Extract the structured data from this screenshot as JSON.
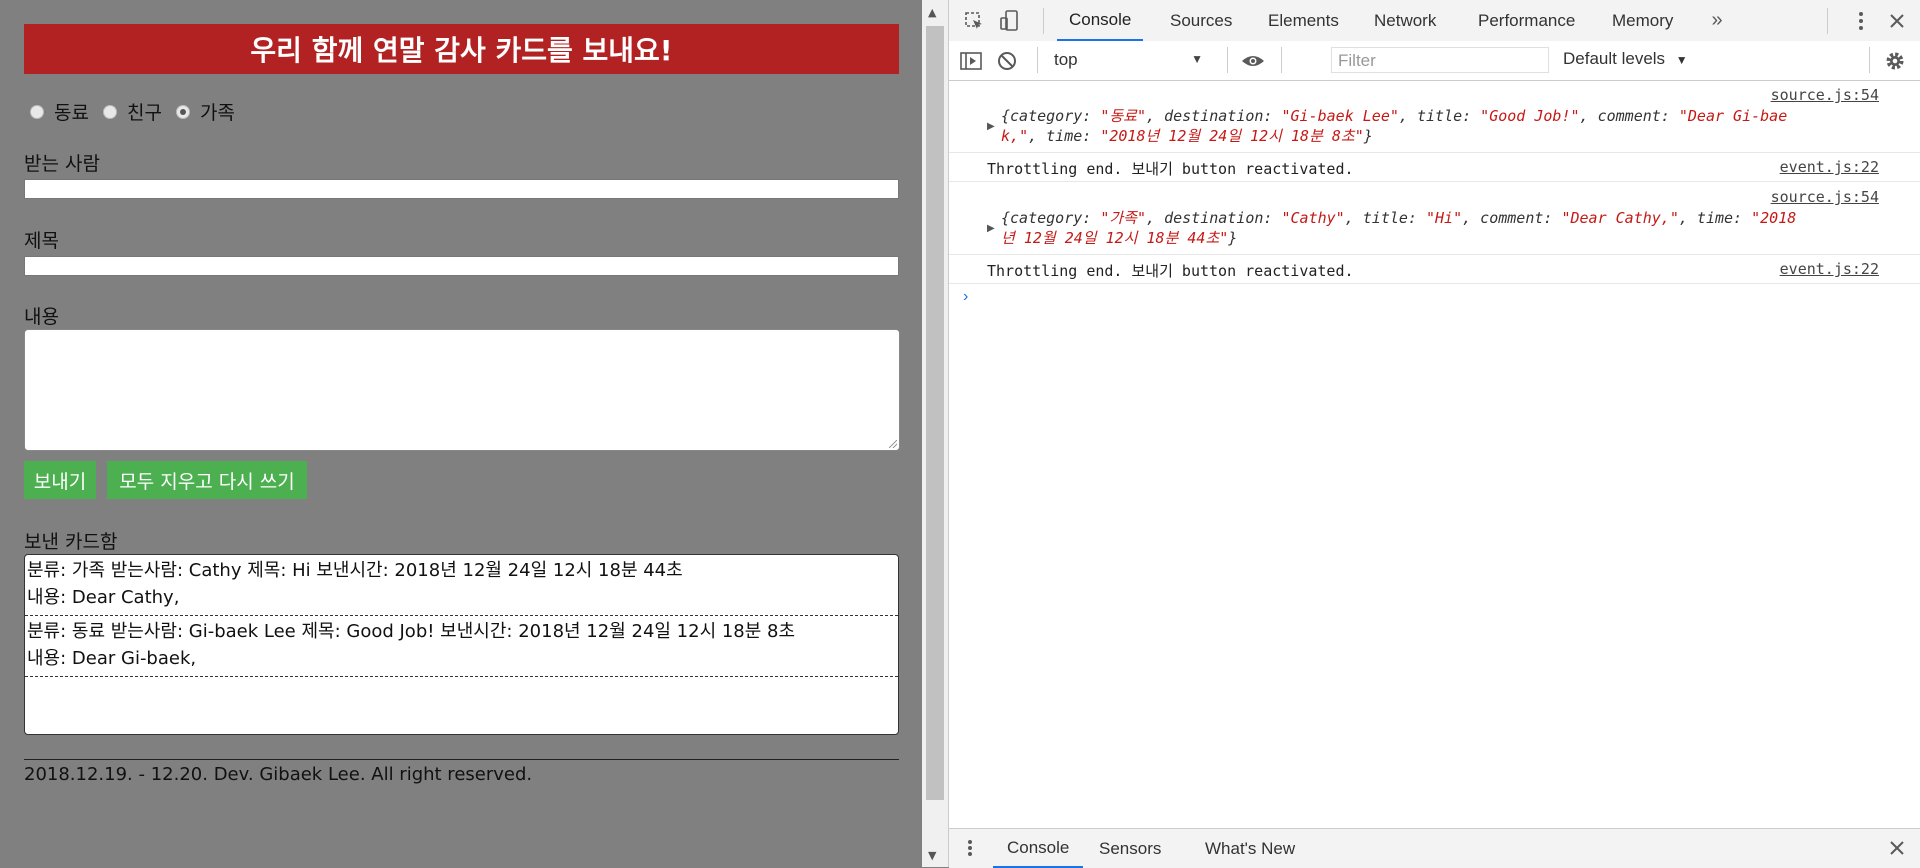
{
  "app": {
    "banner": "우리 함께 연말 감사 카드를 보내요!",
    "categories": [
      {
        "label": "동료",
        "checked": false
      },
      {
        "label": "친구",
        "checked": false
      },
      {
        "label": "가족",
        "checked": true
      }
    ],
    "recipient_label": "받는 사람",
    "recipient_value": "",
    "title_label": "제목",
    "title_value": "",
    "content_label": "내용",
    "content_value": "",
    "send_button": "보내기",
    "reset_button": "모두 지우고 다시 쓰기",
    "sent_box_label": "보낸 카드함",
    "cards": [
      {
        "line1": "분류: 가족 받는사람: Cathy 제목: Hi 보낸시간: 2018년 12월 24일 12시 18분 44초",
        "line2": "내용: Dear Cathy,"
      },
      {
        "line1": "분류: 동료 받는사람: Gi-baek Lee 제목: Good Job! 보낸시간: 2018년 12월 24일 12시 18분 8초",
        "line2": "내용: Dear Gi-baek,"
      }
    ],
    "footer": "2018.12.19. - 12.20. Dev. Gibaek Lee. All right reserved."
  },
  "devtools": {
    "tabs": [
      "Console",
      "Sources",
      "Elements",
      "Network",
      "Performance",
      "Memory"
    ],
    "active_tab": "Console",
    "more_tabs_icon": "chevron-double-right-icon",
    "context": "top",
    "filter_placeholder": "Filter",
    "levels": "Default levels",
    "logs": [
      {
        "source": "source.js:54",
        "object": {
          "category": "동료",
          "destination": "Gi-baek Lee",
          "title": "Good Job!",
          "comment_part1": "Dear Gi-bae",
          "comment_part2": "k,",
          "time": "2018년 12월 24일 12시 18분 8초"
        }
      },
      {
        "source": "event.js:22",
        "message": "Throttling end. 보내기 button reactivated."
      },
      {
        "source": "source.js:54",
        "object": {
          "category": "가족",
          "destination": "Cathy",
          "title": "Hi",
          "comment": "Dear Cathy,",
          "time_part1": "2018",
          "time_part2": "년 12월 24일 12시 18분 44초"
        }
      },
      {
        "source": "event.js:22",
        "message": "Throttling end. 보내기 button reactivated."
      }
    ],
    "drawer_tabs": [
      "Console",
      "Sensors",
      "What's New"
    ],
    "drawer_active": "Console"
  }
}
